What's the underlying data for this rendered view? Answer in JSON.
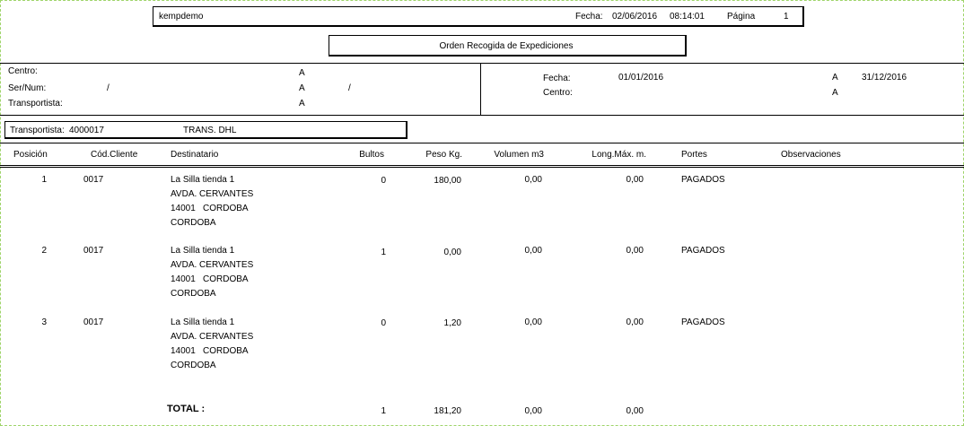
{
  "header": {
    "company": "kempdemo",
    "fecha_label": "Fecha:",
    "fecha": "02/06/2016",
    "hora": "08:14:01",
    "pagina_label": "Página",
    "pagina": "1"
  },
  "title": "Orden Recogida de Expediciones",
  "filters": {
    "centro_label": "Centro:",
    "sernum_label": "Ser/Num:",
    "transportista_label": "Transportista:",
    "a_label": "A",
    "slash": "/",
    "fecha_label": "Fecha:",
    "fecha_desde": "01/01/2016",
    "fecha_hasta": "31/12/2016",
    "centro_right_label": "Centro:"
  },
  "carrier": {
    "label": "Transportista:",
    "code": "4000017",
    "name": "TRANS. DHL"
  },
  "columns": [
    "Posición",
    "Cód.Cliente",
    "Destinatario",
    "Bultos",
    "Peso Kg.",
    "Volumen m3",
    "Long.Máx. m.",
    "Portes",
    "Observaciones"
  ],
  "rows": [
    {
      "pos": "1",
      "cliente": "0017",
      "dest1": "La Silla tienda 1",
      "dest2": "AVDA. CERVANTES",
      "cp": "14001",
      "ciudad": "CORDOBA",
      "prov": "CORDOBA",
      "bultos": "0",
      "peso": "180,00",
      "volumen": "0,00",
      "long": "0,00",
      "portes": "PAGADOS"
    },
    {
      "pos": "2",
      "cliente": "0017",
      "dest1": "La Silla tienda 1",
      "dest2": "AVDA. CERVANTES",
      "cp": "14001",
      "ciudad": "CORDOBA",
      "prov": "CORDOBA",
      "bultos": "1",
      "peso": "0,00",
      "volumen": "0,00",
      "long": "0,00",
      "portes": "PAGADOS"
    },
    {
      "pos": "3",
      "cliente": "0017",
      "dest1": "La Silla tienda 1",
      "dest2": "AVDA. CERVANTES",
      "cp": "14001",
      "ciudad": "CORDOBA",
      "prov": "CORDOBA",
      "bultos": "0",
      "peso": "1,20",
      "volumen": "0,00",
      "long": "0,00",
      "portes": "PAGADOS"
    }
  ],
  "total": {
    "label": "TOTAL :",
    "bultos": "1",
    "peso": "181,20",
    "volumen": "0,00",
    "long": "0,00"
  }
}
